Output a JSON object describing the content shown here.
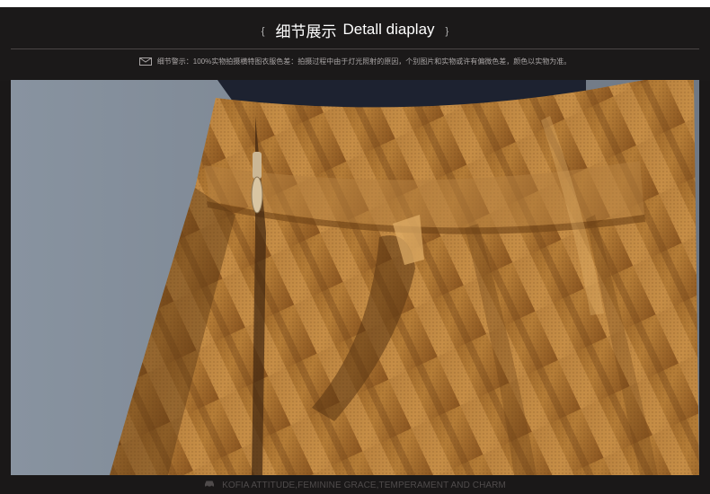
{
  "header": {
    "title_cn": "细节展示",
    "title_en": "Detall diaplay",
    "brace_left": "{",
    "brace_right": "}",
    "notice": "细节警示：100%实物拍摄横特图衣服色差：拍摄过程中由于灯光照射的原因，个别图片和实物或许有偏微色差，颜色以实物为准。"
  },
  "footer": {
    "slogan": "KOFIA ATTITUDE,FEMININE GRACE,TEMPERAMENT AND CHARM"
  },
  "icons": {
    "notice": "envelope-icon",
    "footer": "car-icon"
  },
  "colors": {
    "background": "#1b1919",
    "fabric": "#a8732f",
    "fabric_highlight": "#d7a25a",
    "backdrop": "#7f8b98"
  }
}
